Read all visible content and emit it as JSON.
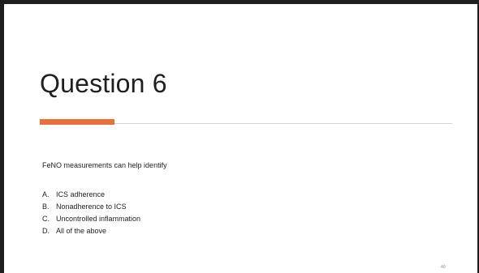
{
  "slide": {
    "title": "Question 6",
    "prompt": "FeNO measurements can help identify",
    "options": [
      {
        "letter": "A.",
        "text": "ICS adherence"
      },
      {
        "letter": "B.",
        "text": "Nonadherence to ICS"
      },
      {
        "letter": "C.",
        "text": "Uncontrolled inflammation"
      },
      {
        "letter": "D.",
        "text": "All of the above"
      }
    ],
    "page_number": "40"
  },
  "colors": {
    "accent": "#e8703a",
    "text": "#1f1f1f",
    "frame": "#1f1f1f",
    "divider": "#d4d4d4",
    "page_number": "#8a8a8a"
  }
}
